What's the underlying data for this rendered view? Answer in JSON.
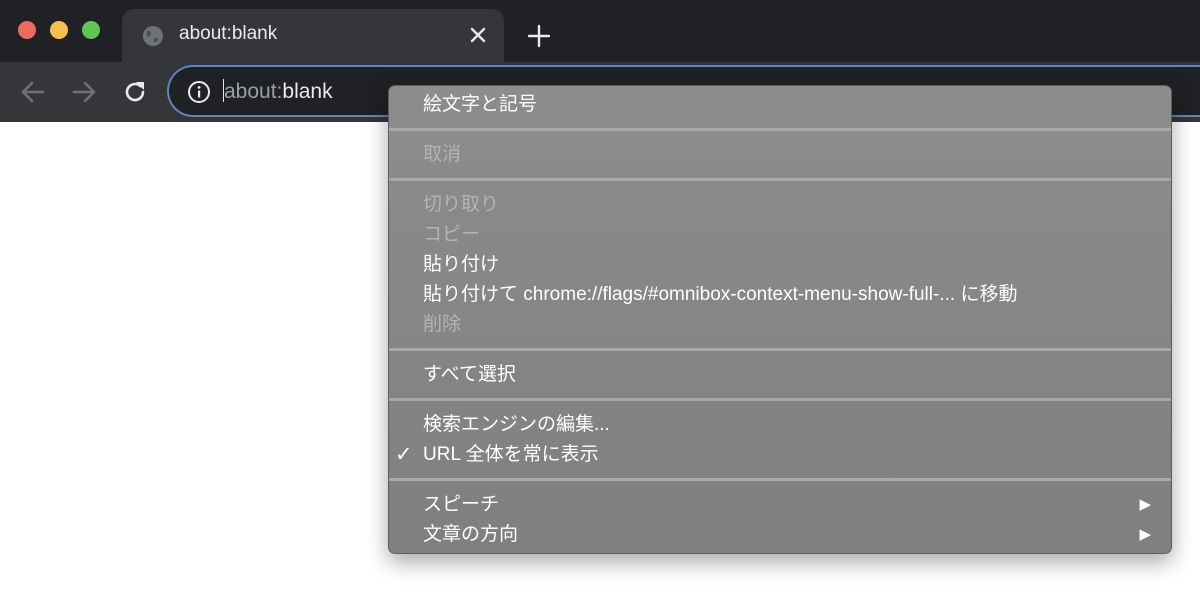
{
  "tab": {
    "title": "about:blank"
  },
  "omnibox": {
    "url_prefix": "about:",
    "url_main": "blank"
  },
  "context_menu": {
    "emoji": "絵文字と記号",
    "undo": "取消",
    "cut": "切り取り",
    "copy": "コピー",
    "paste": "貼り付け",
    "paste_and_go": "貼り付けて chrome://flags/#omnibox-context-menu-show-full-... に移動",
    "delete": "削除",
    "select_all": "すべて選択",
    "edit_search_engines": "検索エンジンの編集...",
    "check_mark": "✓",
    "show_full_url": "URL 全体を常に表示",
    "speech": "スピーチ",
    "text_direction": "文章の方向",
    "submenu_arrow": "▶"
  }
}
